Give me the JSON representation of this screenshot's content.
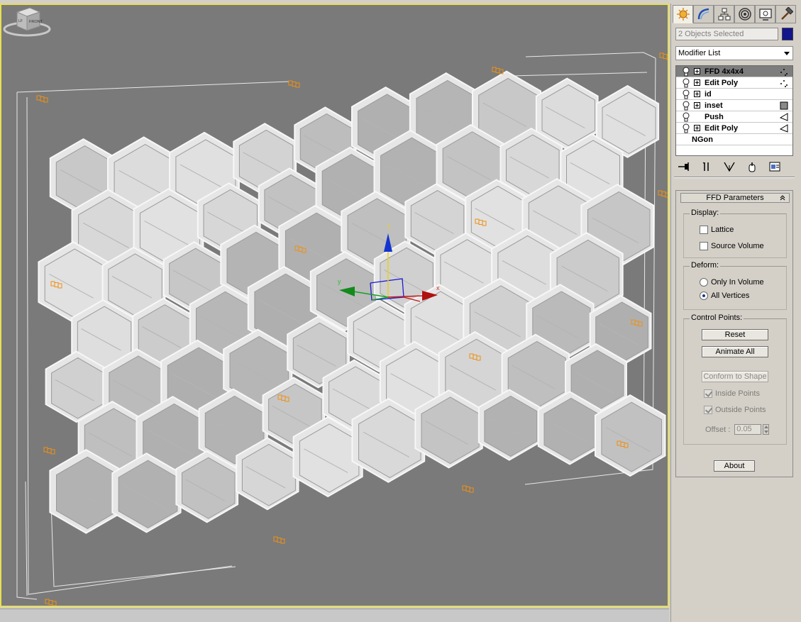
{
  "command_panel": {
    "tabs": [
      {
        "icon": "create-icon",
        "active": true
      },
      {
        "icon": "modify-icon",
        "active": false
      },
      {
        "icon": "hierarchy-icon",
        "active": false
      },
      {
        "icon": "motion-icon",
        "active": false
      },
      {
        "icon": "display-icon",
        "active": false
      },
      {
        "icon": "utilities-icon",
        "active": false
      }
    ],
    "selection_text": "2 Objects Selected",
    "object_color": "#12158c",
    "modifier_list_label": "Modifier List",
    "stack": [
      {
        "label": "FFD 4x4x4",
        "selected": true,
        "expandable": true,
        "icon": "vertex-dots-icon"
      },
      {
        "label": "Edit Poly",
        "selected": false,
        "expandable": true,
        "icon": "vertex-dots-icon"
      },
      {
        "label": "id",
        "selected": false,
        "expandable": true,
        "icon": ""
      },
      {
        "label": "inset",
        "selected": false,
        "expandable": true,
        "icon": "polygon-square-icon"
      },
      {
        "label": "Push",
        "selected": false,
        "expandable": false,
        "icon": "face-triangle-icon"
      },
      {
        "label": "Edit Poly",
        "selected": false,
        "expandable": true,
        "icon": "face-triangle-icon"
      }
    ],
    "base_object": "NGon",
    "stack_tools": [
      "pin-stack-icon",
      "show-end-result-icon",
      "make-unique-icon",
      "remove-modifier-icon",
      "configure-sets-icon"
    ]
  },
  "ffd": {
    "title": "FFD Parameters",
    "display_label": "Display:",
    "lattice_label": "Lattice",
    "lattice_checked": false,
    "source_volume_label": "Source Volume",
    "source_volume_checked": false,
    "deform_label": "Deform:",
    "only_in_volume_label": "Only In Volume",
    "all_vertices_label": "All Vertices",
    "deform_selected": "All Vertices",
    "control_points_label": "Control Points:",
    "reset_label": "Reset",
    "animate_all_label": "Animate All",
    "conform_label": "Conform to Shape",
    "inside_points_label": "Inside Points",
    "outside_points_label": "Outside Points",
    "offset_label": "Offset :",
    "offset_value": "0.05",
    "about_label": "About"
  },
  "viewport": {
    "border_color": "#e7e052",
    "background": "#7a7a7a",
    "gizmo_axes": [
      "x",
      "y",
      "z"
    ],
    "viewcube_label": "FRONT",
    "viewcube_side_label": "LF"
  }
}
